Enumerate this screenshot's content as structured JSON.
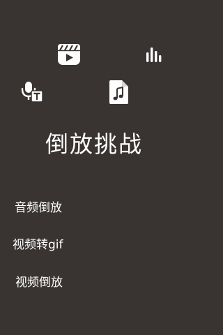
{
  "app": {
    "title": "倒放挑战"
  },
  "icons": {
    "video": "video-clapper-icon",
    "levels": "audio-levels-icon",
    "voice": "voice-to-text-icon",
    "audio": "music-file-icon"
  },
  "menu": {
    "items": [
      {
        "label": "音频倒放"
      },
      {
        "label": "视频转gif"
      },
      {
        "label": "视频倒放"
      }
    ]
  },
  "colors": {
    "background": "#393432",
    "foreground": "#ffffff"
  }
}
